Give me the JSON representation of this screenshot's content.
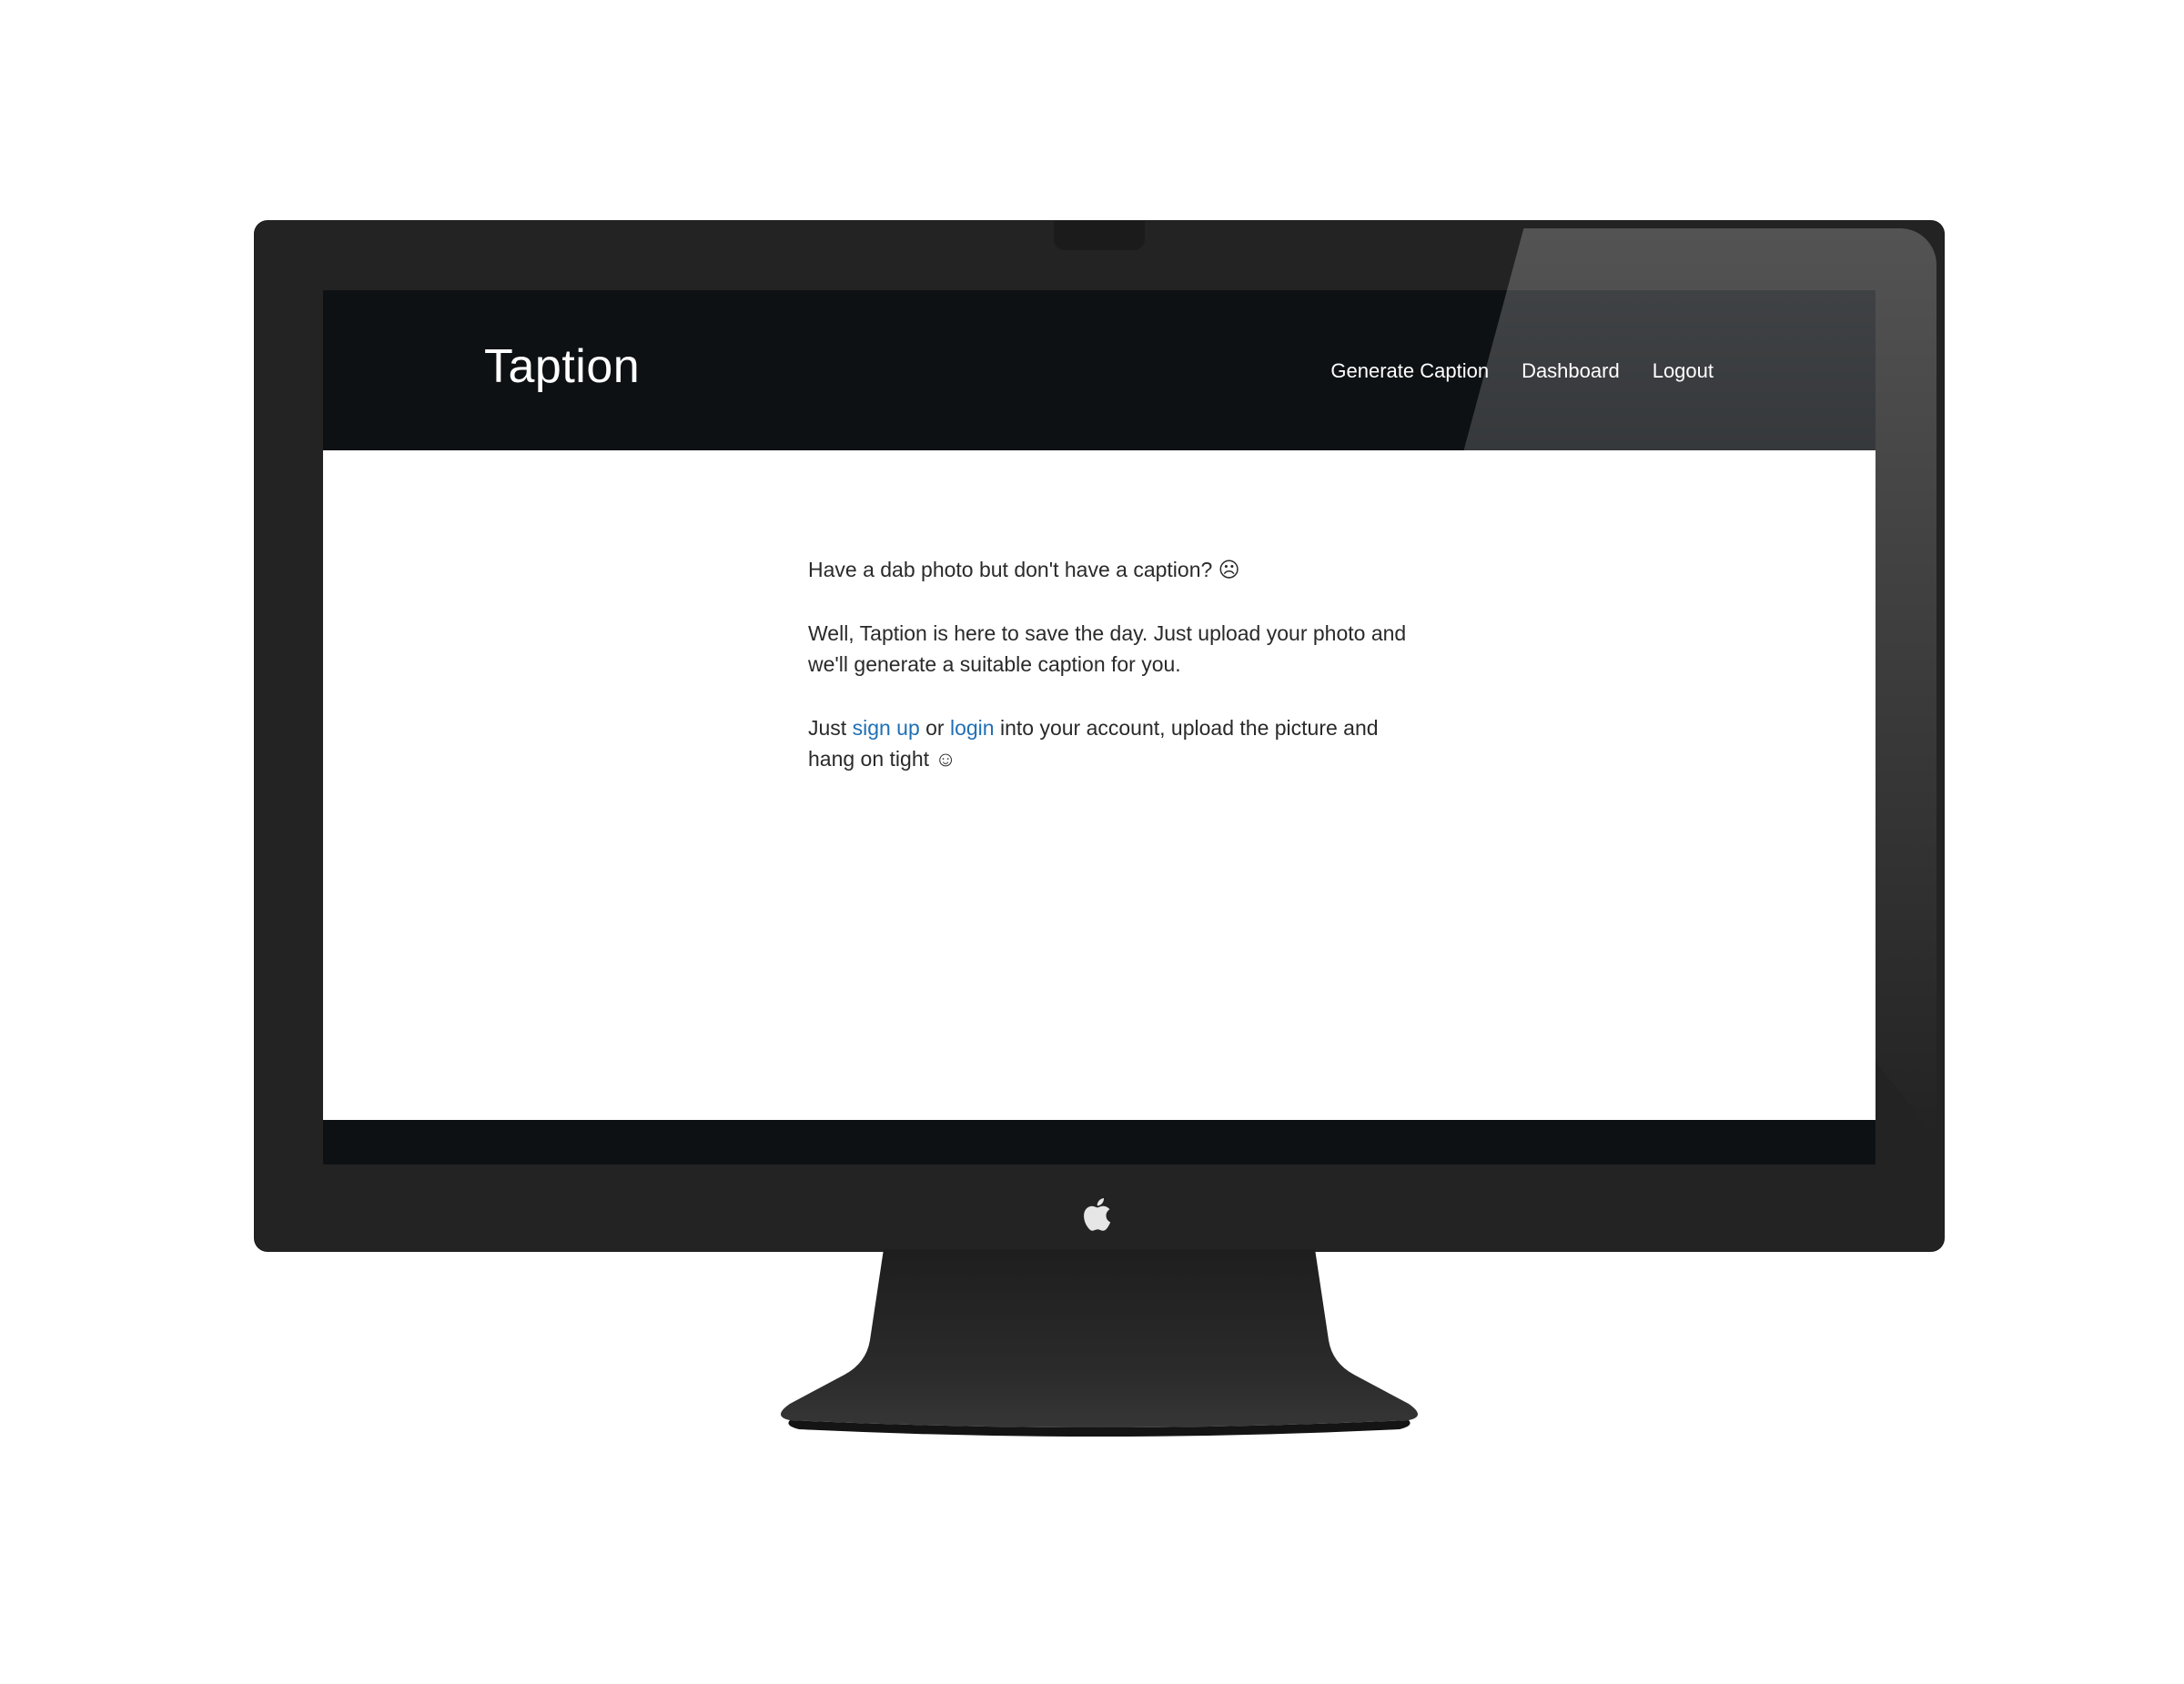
{
  "app": {
    "brand": "Taption"
  },
  "nav": {
    "items": [
      {
        "label": "Generate Caption"
      },
      {
        "label": "Dashboard"
      },
      {
        "label": "Logout"
      }
    ]
  },
  "main": {
    "line1": "Have a dab photo but don't have a caption? ☹",
    "line2": "Well, Taption is here to save the day. Just upload your photo and we'll generate a suitable caption for you.",
    "line3_prefix": "Just ",
    "signup_link": "sign up",
    "or_text": " or ",
    "login_link": "login",
    "line3_suffix": " into your account, upload the picture and hang on tight ☺"
  },
  "colors": {
    "navbar_bg": "#0e1114",
    "link": "#1f6fb5",
    "bezel": "#232323"
  },
  "icons": {
    "frame_logo": "apple-icon"
  }
}
